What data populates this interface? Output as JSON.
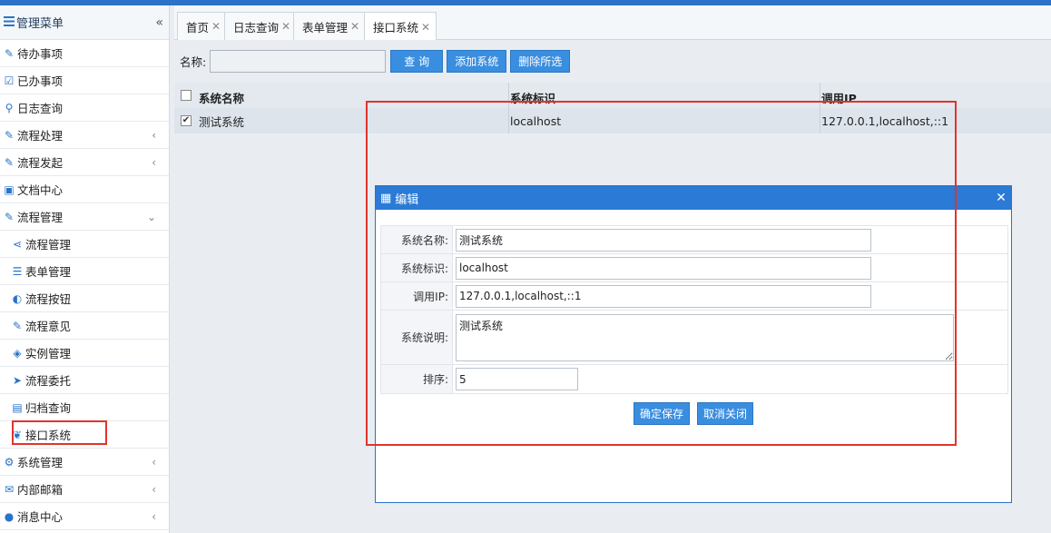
{
  "sidebar": {
    "title": "管理菜单",
    "collapse_glyph": "«",
    "items": [
      {
        "label": "待办事项",
        "icon": "edit-icon",
        "glyph": "✎",
        "arrow": ""
      },
      {
        "label": "已办事项",
        "icon": "check-square-icon",
        "glyph": "☑",
        "arrow": ""
      },
      {
        "label": "日志查询",
        "icon": "search-icon",
        "glyph": "⚲",
        "arrow": ""
      },
      {
        "label": "流程处理",
        "icon": "edit-square-icon",
        "glyph": "✎",
        "arrow": "‹"
      },
      {
        "label": "流程发起",
        "icon": "edit-square-icon",
        "glyph": "✎",
        "arrow": "‹"
      },
      {
        "label": "文档中心",
        "icon": "briefcase-icon",
        "glyph": "▣",
        "arrow": ""
      },
      {
        "label": "流程管理",
        "icon": "edit-square-icon",
        "glyph": "✎",
        "arrow": "⌄"
      }
    ],
    "sub_items": [
      {
        "label": "流程管理",
        "icon": "share-icon",
        "glyph": "⋖"
      },
      {
        "label": "表单管理",
        "icon": "list-icon",
        "glyph": "☰"
      },
      {
        "label": "流程按钮",
        "icon": "toggle-icon",
        "glyph": "◐"
      },
      {
        "label": "流程意见",
        "icon": "edit-square-icon",
        "glyph": "✎"
      },
      {
        "label": "实例管理",
        "icon": "cube-icon",
        "glyph": "◈"
      },
      {
        "label": "流程委托",
        "icon": "send-icon",
        "glyph": "➤"
      },
      {
        "label": "归档查询",
        "icon": "archive-icon",
        "glyph": "▤"
      },
      {
        "label": "接口系统",
        "icon": "leaf-icon",
        "glyph": "❦"
      }
    ],
    "bottom_items": [
      {
        "label": "系统管理",
        "icon": "gear-icon",
        "glyph": "⚙",
        "arrow": "‹"
      },
      {
        "label": "内部邮箱",
        "icon": "envelope-icon",
        "glyph": "✉",
        "arrow": "‹"
      },
      {
        "label": "消息中心",
        "icon": "chat-icon",
        "glyph": "●",
        "arrow": "‹"
      }
    ]
  },
  "tabs": [
    {
      "label": "首页",
      "close": "✕"
    },
    {
      "label": "日志查询",
      "close": "✕"
    },
    {
      "label": "表单管理",
      "close": "✕"
    },
    {
      "label": "接口系统",
      "close": "✕"
    }
  ],
  "toolbar": {
    "name_label": "名称:",
    "name_value": "",
    "query_label": "查 询",
    "add_label": "添加系统",
    "delete_label": "删除所选"
  },
  "grid": {
    "headers": [
      "系统名称",
      "系统标识",
      "调用IP"
    ],
    "rows": [
      {
        "checked": true,
        "check_glyph": "✔",
        "name": "测试系统",
        "code": "localhost",
        "ip": "127.0.0.1,localhost,::1"
      }
    ]
  },
  "dialog": {
    "icon_glyph": "▦",
    "title": "编辑",
    "close_glyph": "✕",
    "fields": {
      "name_label": "系统名称:",
      "name_value": "测试系统",
      "code_label": "系统标识:",
      "code_value": "localhost",
      "ip_label": "调用IP:",
      "ip_value": "127.0.0.1,localhost,::1",
      "desc_label": "系统说明:",
      "desc_value": "测试系统",
      "order_label": "排序:",
      "order_value": "5"
    },
    "save_label": "确定保存",
    "cancel_label": "取消关闭"
  },
  "colors": {
    "accent": "#2a7ad6",
    "button": "#3a8ee0",
    "highlight": "#e0342d"
  }
}
